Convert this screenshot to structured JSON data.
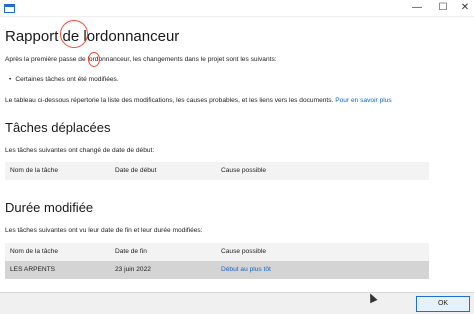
{
  "window": {
    "title": ""
  },
  "report": {
    "title": "Rapport de lordonnanceur",
    "intro": "Après la première passe de lordonnanceur, les changements dans le projet sont les suivants:",
    "bullet": "Certaines tâches ont été modifiées.",
    "note": "Le tableau ci-dessous répertorie la liste des modifications, les causes probables, et les liens vers les documents.",
    "link": "Pour en savoir plus"
  },
  "moved_tasks": {
    "title": "Tâches déplacées",
    "description": "Les tâches suivantes ont changé de date de début:",
    "columns": [
      "Nom de la tâche",
      "Date de début",
      "Cause possible"
    ],
    "rows": []
  },
  "duration_changed": {
    "title": "Durée modifiée",
    "description": "Les tâches suivantes ont vu leur date de fin et leur durée modifiées:",
    "columns": [
      "Nom de la tâche",
      "Date de fin",
      "Cause possible"
    ],
    "rows": [
      {
        "name": "LES ARPENTS",
        "date": "23 juin 2022",
        "cause": "Début au plus tôt"
      }
    ]
  },
  "footer": {
    "ok_label": "OK"
  },
  "icons": {
    "minimize": "minimize-icon",
    "maximize": "maximize-icon",
    "close": "close-icon"
  },
  "colors": {
    "link": "#1565c0",
    "annotation": "#e8503a",
    "selected_row": "#d4d4d4"
  }
}
